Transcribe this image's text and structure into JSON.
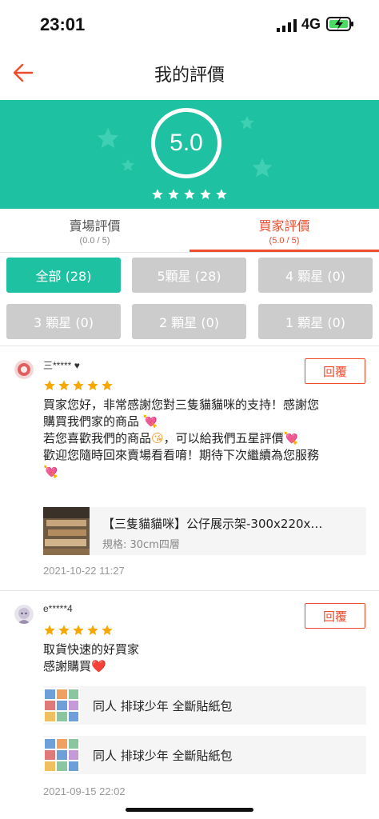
{
  "status_bar": {
    "time": "23:01",
    "network": "4G"
  },
  "header": {
    "title": "我的評價"
  },
  "summary": {
    "score": "5.0",
    "star_count": 5
  },
  "tabs": [
    {
      "label": "賣場評價",
      "sub": "(0.0 / 5)",
      "active": false
    },
    {
      "label": "買家評價",
      "sub": "(5.0 / 5)",
      "active": true
    }
  ],
  "filters": [
    {
      "label": "全部 (28)",
      "selected": true
    },
    {
      "label": "5顆星 (28)",
      "selected": false
    },
    {
      "label": "4 顆星 (0)",
      "selected": false
    },
    {
      "label": "3 顆星 (0)",
      "selected": false
    },
    {
      "label": "2 顆星 (0)",
      "selected": false
    },
    {
      "label": "1 顆星 (0)",
      "selected": false
    }
  ],
  "reviews": [
    {
      "username": "三*****",
      "rating": 5,
      "reply_label": "回覆",
      "text_lines": [
        "買家您好，非常感謝您對三隻貓貓咪的支持！感謝您",
        "購買我們家的商品",
        "若您喜歡我們的商品",
        "，可以給我們五星評價",
        "歡迎您隨時回來賣場看看唷！期待下次繼續為您服務"
      ],
      "product": {
        "name": "【三隻貓貓咪】公仔展示架-300x220x…",
        "spec": "規格: 30cm四層"
      },
      "date": "2021-10-22 11:27"
    },
    {
      "username": "e*****4",
      "rating": 5,
      "reply_label": "回覆",
      "text_lines": [
        "取貨快速的好買家",
        "感謝購買"
      ],
      "products": [
        {
          "name": "同人 排球少年 全斷貼紙包"
        },
        {
          "name": "同人 排球少年 全斷貼紙包"
        }
      ],
      "date": "2021-09-15 22:02"
    }
  ],
  "colors": {
    "accent": "#1ec2a2",
    "brand": "#ee4d2d",
    "star": "#f6a700",
    "disabled": "#cccccc"
  }
}
